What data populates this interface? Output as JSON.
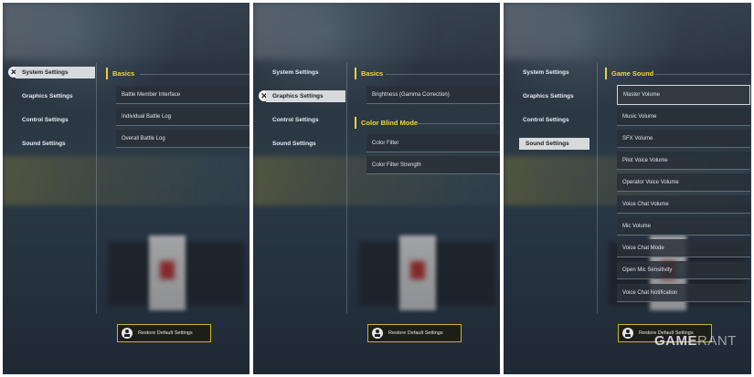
{
  "panel1": {
    "sidebar": [
      "System Settings",
      "Graphics Settings",
      "Control Settings",
      "Sound Settings"
    ],
    "active_index": 0,
    "sections": [
      {
        "title": "Basics",
        "items": [
          "Battle Member Interface",
          "Individual Battle Log",
          "Overall Battle Log"
        ]
      }
    ],
    "restore_label": "Restore Default Settings"
  },
  "panel2": {
    "sidebar": [
      "System Settings",
      "Graphics Settings",
      "Control Settings",
      "Sound Settings"
    ],
    "active_index": 1,
    "sections": [
      {
        "title": "Basics",
        "items": [
          "Brightness (Gamma Correction)"
        ]
      },
      {
        "title": "Color Blind Mode",
        "items": [
          "Color Filter",
          "Color Filter Strength"
        ]
      }
    ],
    "restore_label": "Restore Default Settings"
  },
  "panel3": {
    "sidebar": [
      "System Settings",
      "Graphics Settings",
      "Control Settings",
      "Sound Settings"
    ],
    "active_index": 3,
    "sections": [
      {
        "title": "Game Sound",
        "items": [
          "Master Volume",
          "Music Volume",
          "SFX Volume",
          "Pilot Voice Volume",
          "Operator Voice Volume",
          "Voice Chat Volume",
          "Mic Volume",
          "Voice Chat Mode",
          "Open Mic Sensitivity",
          "Voice Chat Notification"
        ]
      }
    ],
    "highlighted_item": "Master Volume",
    "restore_label": "Restore Default Settings"
  },
  "watermark": {
    "main": "GAME",
    "accent": "RANT"
  },
  "colors": {
    "accent_yellow": "#f0d83c",
    "active_tab": "#d7dadc",
    "panel_bg": "#2a3440"
  }
}
